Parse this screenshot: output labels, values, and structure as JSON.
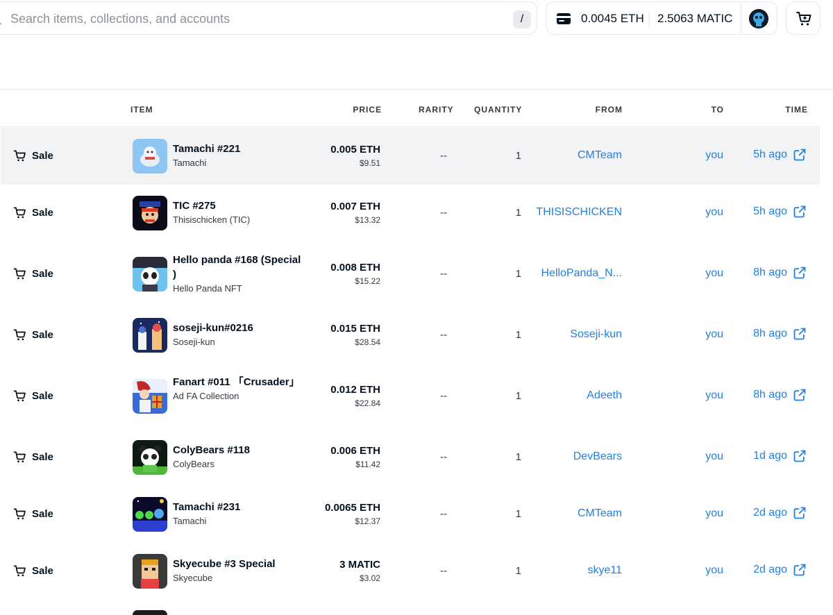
{
  "search": {
    "placeholder": "Search items, collections, and accounts",
    "shortcut": "/"
  },
  "wallet": {
    "eth_balance": "0.0045 ETH",
    "matic_balance": "2.5063 MATIC"
  },
  "table": {
    "headers": {
      "item": "ITEM",
      "price": "PRICE",
      "rarity": "RARITY",
      "quantity": "QUANTITY",
      "from": "FROM",
      "to": "TO",
      "time": "TIME"
    },
    "rows": [
      {
        "event": "Sale",
        "name": "Tamachi #221",
        "collection": "Tamachi",
        "price": "0.005 ETH",
        "usd": "$9.51",
        "rarity": "--",
        "quantity": "1",
        "from": "CMTeam",
        "to": "you",
        "time": "5h ago"
      },
      {
        "event": "Sale",
        "name": "TIC #275",
        "collection": "Thisischicken (TIC)",
        "price": "0.007 ETH",
        "usd": "$13.32",
        "rarity": "--",
        "quantity": "1",
        "from": "THISISCHICKEN",
        "to": "you",
        "time": "5h ago"
      },
      {
        "event": "Sale",
        "name": "Hello panda #168 (Special )",
        "collection": "Hello Panda NFT",
        "price": "0.008 ETH",
        "usd": "$15.22",
        "rarity": "--",
        "quantity": "1",
        "from": "HelloPanda_N...",
        "to": "you",
        "time": "8h ago"
      },
      {
        "event": "Sale",
        "name": "soseji-kun#0216",
        "collection": "Soseji-kun",
        "price": "0.015 ETH",
        "usd": "$28.54",
        "rarity": "--",
        "quantity": "1",
        "from": "Soseji-kun",
        "to": "you",
        "time": "8h ago"
      },
      {
        "event": "Sale",
        "name": "Fanart #011 「Crusader」",
        "collection": "Ad FA Collection",
        "price": "0.012 ETH",
        "usd": "$22.84",
        "rarity": "--",
        "quantity": "1",
        "from": "Adeeth",
        "to": "you",
        "time": "8h ago"
      },
      {
        "event": "Sale",
        "name": "ColyBears #118",
        "collection": "ColyBears",
        "price": "0.006 ETH",
        "usd": "$11.42",
        "rarity": "--",
        "quantity": "1",
        "from": "DevBears",
        "to": "you",
        "time": "1d ago"
      },
      {
        "event": "Sale",
        "name": "Tamachi #231",
        "collection": "Tamachi",
        "price": "0.0065 ETH",
        "usd": "$12.37",
        "rarity": "--",
        "quantity": "1",
        "from": "CMTeam",
        "to": "you",
        "time": "2d ago"
      },
      {
        "event": "Sale",
        "name": "Skyecube #3 Special",
        "collection": "Skyecube",
        "price": "3 MATIC",
        "usd": "$3.02",
        "rarity": "--",
        "quantity": "1",
        "from": "skye11",
        "to": "you",
        "time": "2d ago"
      }
    ]
  }
}
